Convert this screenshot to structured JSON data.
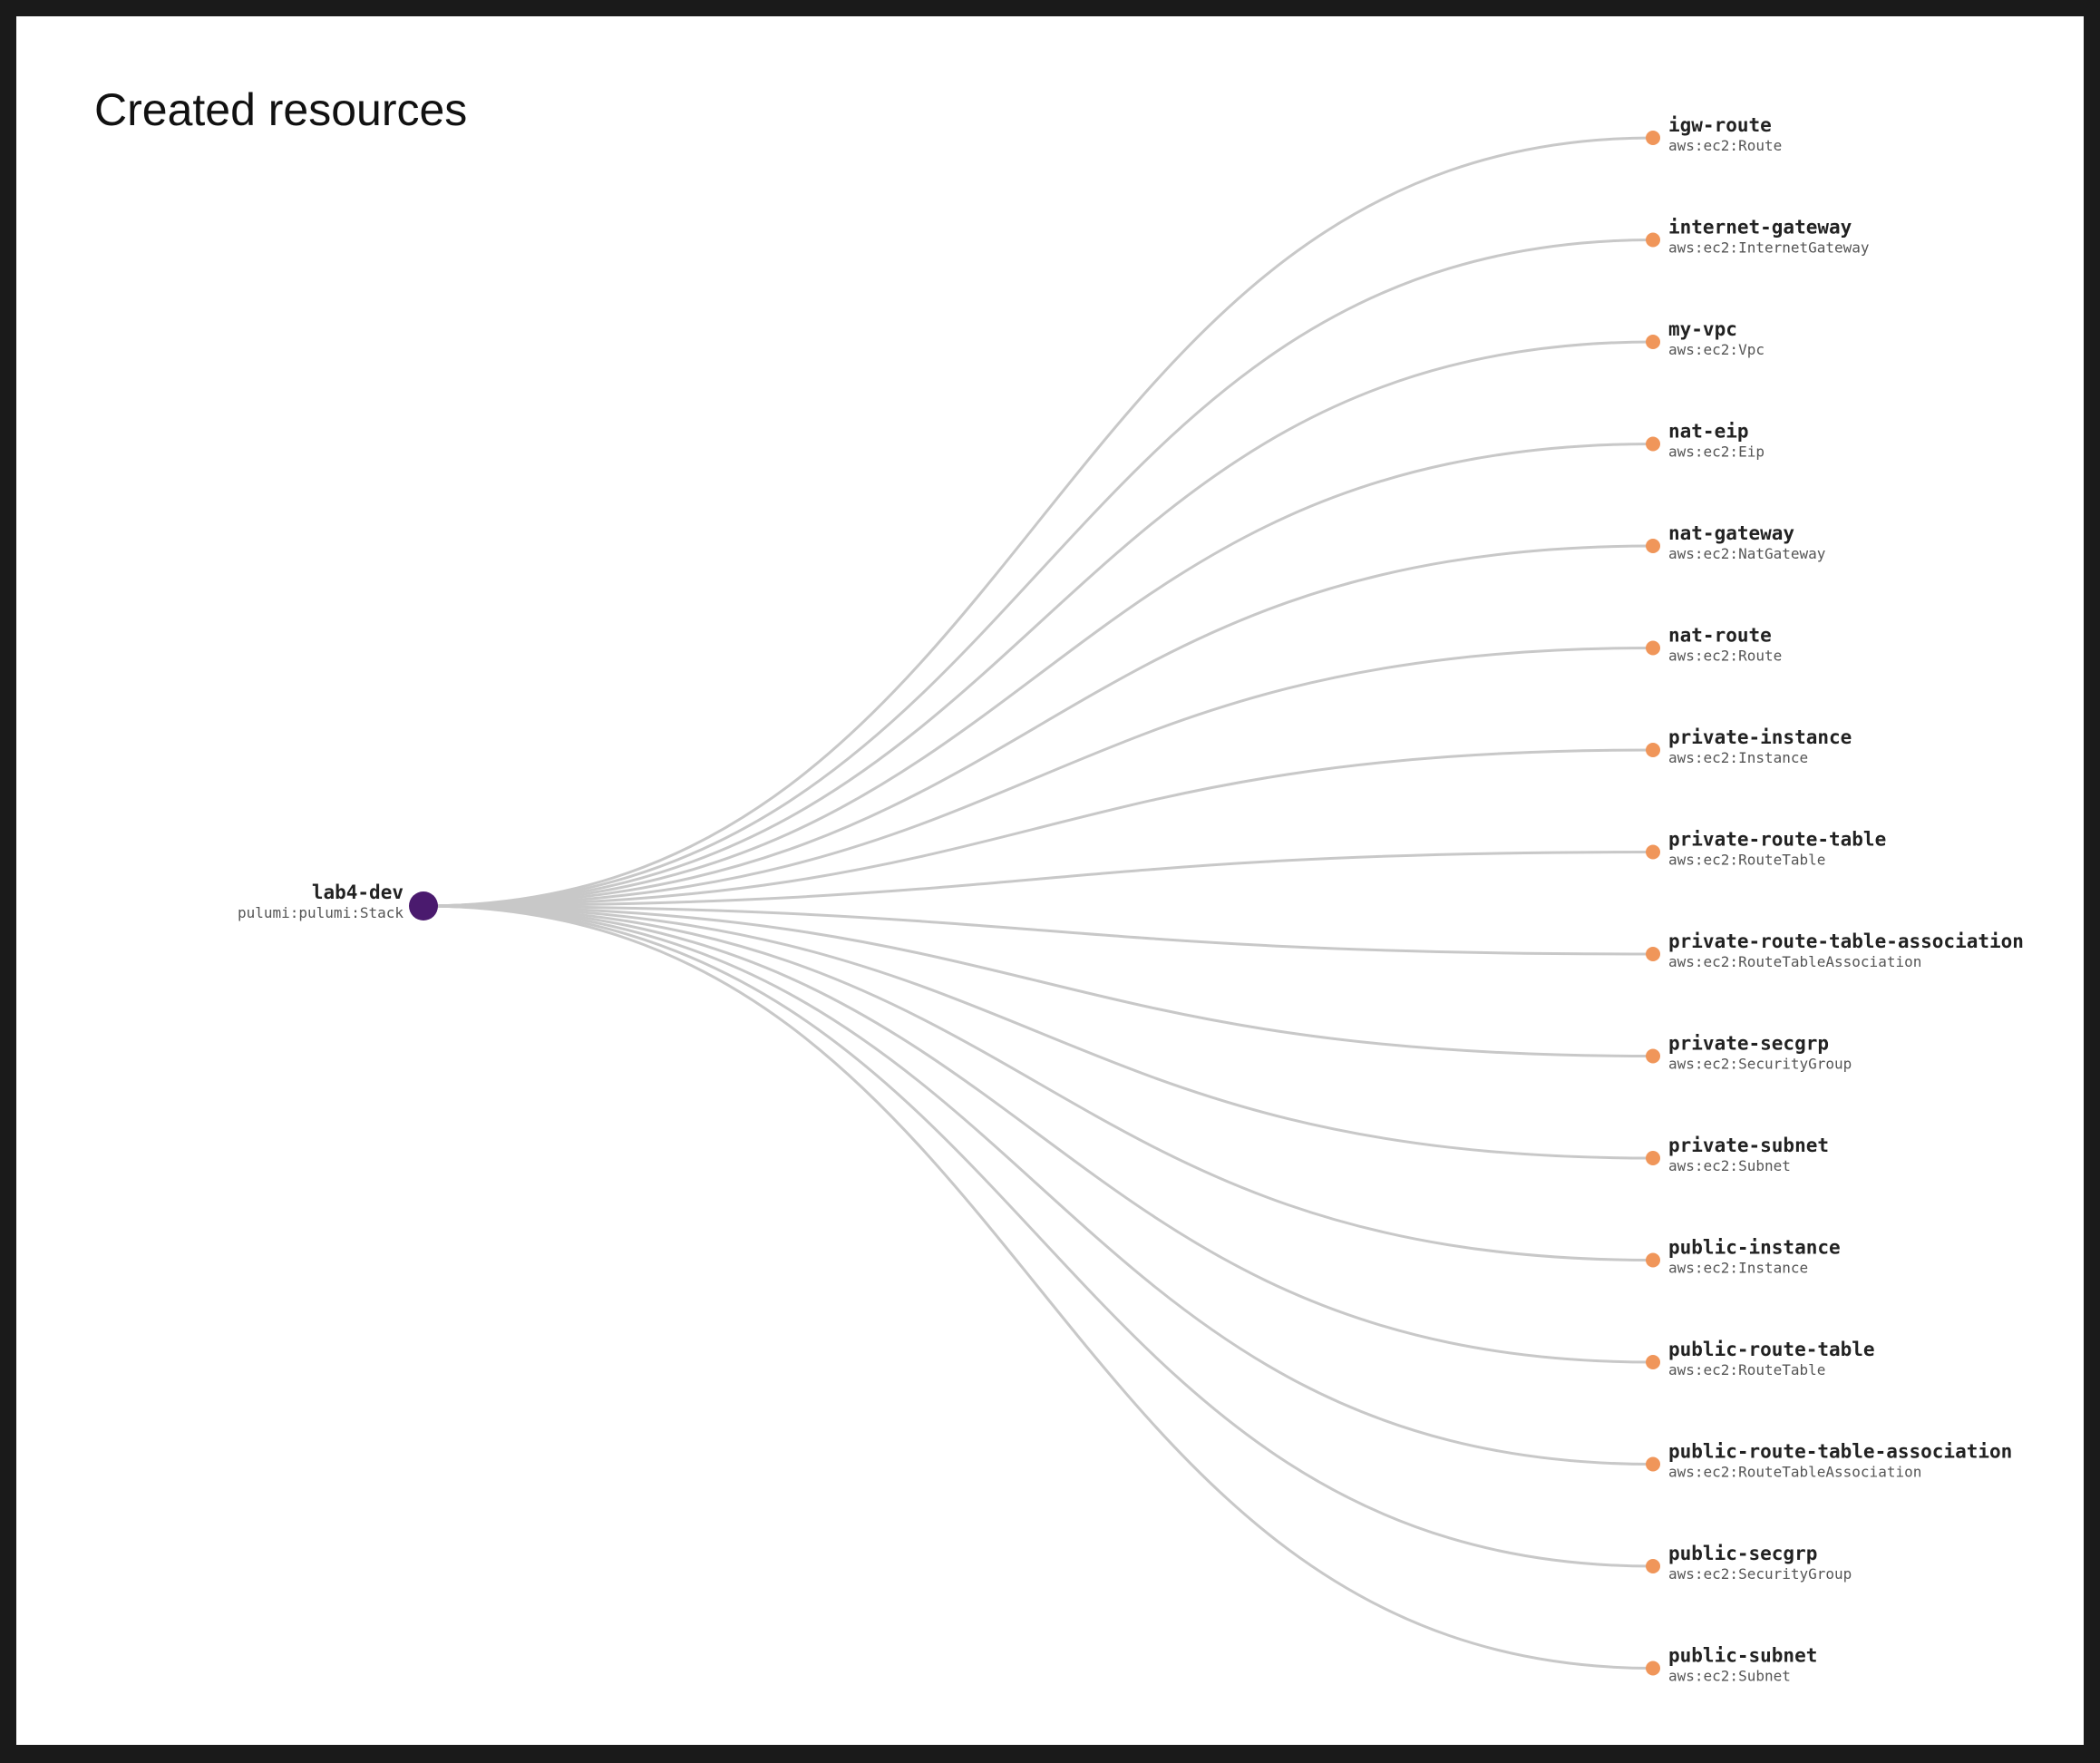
{
  "title": "Created resources",
  "colors": {
    "background": "#ffffff",
    "root_node": "#4a1a6e",
    "child_node": "#f0965a",
    "edge": "#c8c8c8"
  },
  "root": {
    "name": "lab4-dev",
    "type": "pulumi:pulumi:Stack"
  },
  "children": [
    {
      "name": "igw-route",
      "type": "aws:ec2:Route"
    },
    {
      "name": "internet-gateway",
      "type": "aws:ec2:InternetGateway"
    },
    {
      "name": "my-vpc",
      "type": "aws:ec2:Vpc"
    },
    {
      "name": "nat-eip",
      "type": "aws:ec2:Eip"
    },
    {
      "name": "nat-gateway",
      "type": "aws:ec2:NatGateway"
    },
    {
      "name": "nat-route",
      "type": "aws:ec2:Route"
    },
    {
      "name": "private-instance",
      "type": "aws:ec2:Instance"
    },
    {
      "name": "private-route-table",
      "type": "aws:ec2:RouteTable"
    },
    {
      "name": "private-route-table-association",
      "type": "aws:ec2:RouteTableAssociation"
    },
    {
      "name": "private-secgrp",
      "type": "aws:ec2:SecurityGroup"
    },
    {
      "name": "private-subnet",
      "type": "aws:ec2:Subnet"
    },
    {
      "name": "public-instance",
      "type": "aws:ec2:Instance"
    },
    {
      "name": "public-route-table",
      "type": "aws:ec2:RouteTable"
    },
    {
      "name": "public-route-table-association",
      "type": "aws:ec2:RouteTableAssociation"
    },
    {
      "name": "public-secgrp",
      "type": "aws:ec2:SecurityGroup"
    },
    {
      "name": "public-subnet",
      "type": "aws:ec2:Subnet"
    }
  ]
}
